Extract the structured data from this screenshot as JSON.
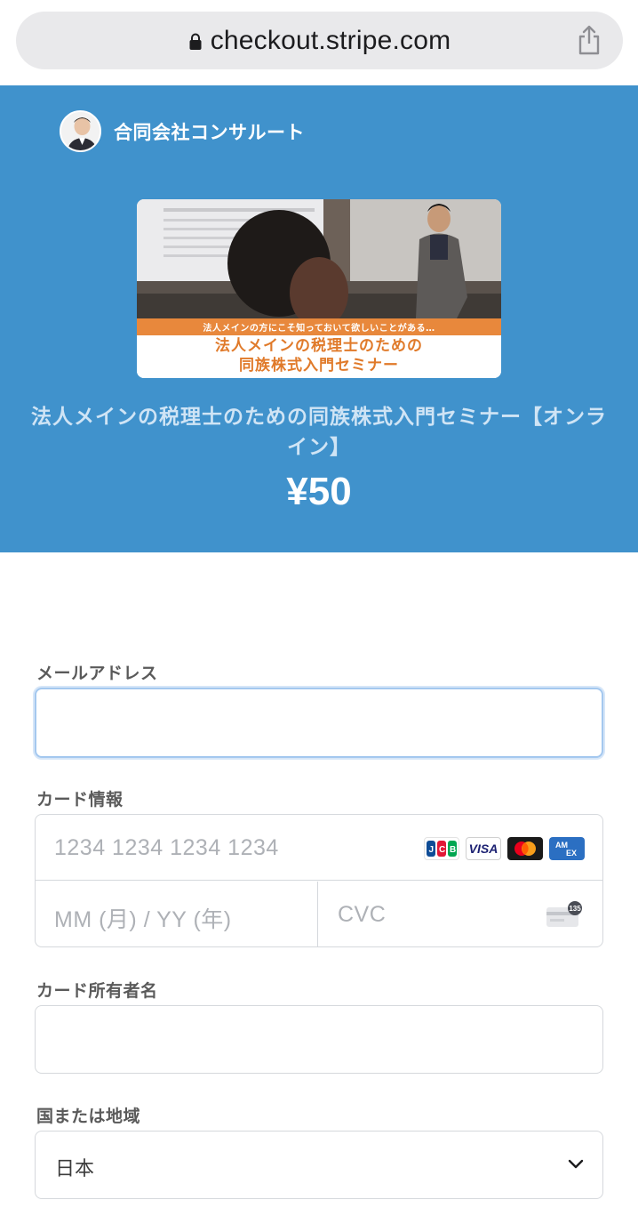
{
  "browser": {
    "url": "checkout.stripe.com",
    "lock_icon": "lock-icon",
    "share_icon": "share-icon"
  },
  "merchant": {
    "name": "合同会社コンサルート",
    "avatar_icon": "avatar"
  },
  "product": {
    "image_banner_strip": "法人メインの方にこそ知っておいて欲しいことがある…",
    "image_banner_line1": "法人メインの税理士のための",
    "image_banner_line2": "同族株式入門セミナー",
    "title": "法人メインの税理士のための同族株式入門セミナー【オンライン】",
    "price": "¥50"
  },
  "form": {
    "email_label": "メールアドレス",
    "email_value": "",
    "card_label": "カード情報",
    "card_number_placeholder": "1234 1234 1234 1234",
    "card_brands": [
      "JCB",
      "VISA",
      "Mastercard",
      "AMEX"
    ],
    "expiry_placeholder": "MM (月) / YY (年)",
    "cvc_placeholder": "CVC",
    "cvc_badge": "135",
    "cardholder_label": "カード所有者名",
    "cardholder_value": "",
    "country_label": "国または地域",
    "country_value": "日本"
  },
  "colors": {
    "hero_background": "#4092cc",
    "focus_ring": "#a4c8ef",
    "banner_orange": "#e8883c"
  }
}
